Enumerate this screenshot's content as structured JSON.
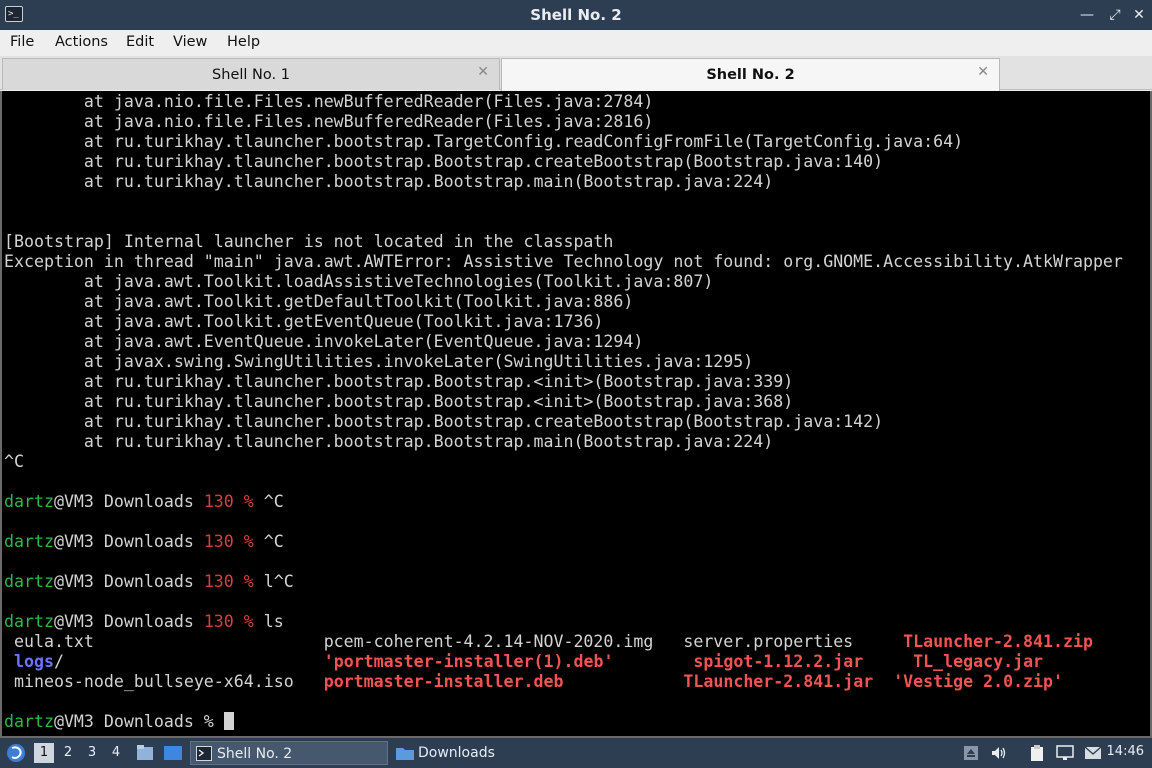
{
  "window": {
    "title": "Shell No. 2",
    "controls": {
      "minimize": "—",
      "maximize": "⤢",
      "close": "✕"
    }
  },
  "menu": [
    "File",
    "Actions",
    "Edit",
    "View",
    "Help"
  ],
  "tabs": [
    {
      "label": "Shell No. 1",
      "close": "✕",
      "active": false
    },
    {
      "label": "Shell No. 2",
      "close": "✕",
      "active": true
    }
  ],
  "terminal": {
    "lines": [
      [
        {
          "t": "        at java.nio.file.Files.newBufferedReader(Files.java:2784)"
        }
      ],
      [
        {
          "t": "        at java.nio.file.Files.newBufferedReader(Files.java:2816)"
        }
      ],
      [
        {
          "t": "        at ru.turikhay.tlauncher.bootstrap.TargetConfig.readConfigFromFile(TargetConfig.java:64)"
        }
      ],
      [
        {
          "t": "        at ru.turikhay.tlauncher.bootstrap.Bootstrap.createBootstrap(Bootstrap.java:140)"
        }
      ],
      [
        {
          "t": "        at ru.turikhay.tlauncher.bootstrap.Bootstrap.main(Bootstrap.java:224)"
        }
      ],
      [],
      [],
      [
        {
          "t": "[Bootstrap] Internal launcher is not located in the classpath"
        }
      ],
      [
        {
          "t": "Exception in thread \"main\" java.awt.AWTError: Assistive Technology not found: org.GNOME.Accessibility.AtkWrapper"
        }
      ],
      [
        {
          "t": "        at java.awt.Toolkit.loadAssistiveTechnologies(Toolkit.java:807)"
        }
      ],
      [
        {
          "t": "        at java.awt.Toolkit.getDefaultToolkit(Toolkit.java:886)"
        }
      ],
      [
        {
          "t": "        at java.awt.Toolkit.getEventQueue(Toolkit.java:1736)"
        }
      ],
      [
        {
          "t": "        at java.awt.EventQueue.invokeLater(EventQueue.java:1294)"
        }
      ],
      [
        {
          "t": "        at javax.swing.SwingUtilities.invokeLater(SwingUtilities.java:1295)"
        }
      ],
      [
        {
          "t": "        at ru.turikhay.tlauncher.bootstrap.Bootstrap.<init>(Bootstrap.java:339)"
        }
      ],
      [
        {
          "t": "        at ru.turikhay.tlauncher.bootstrap.Bootstrap.<init>(Bootstrap.java:368)"
        }
      ],
      [
        {
          "t": "        at ru.turikhay.tlauncher.bootstrap.Bootstrap.createBootstrap(Bootstrap.java:142)"
        }
      ],
      [
        {
          "t": "        at ru.turikhay.tlauncher.bootstrap.Bootstrap.main(Bootstrap.java:224)"
        }
      ],
      [
        {
          "t": "^C"
        }
      ],
      [],
      [
        {
          "t": "dartz",
          "c": "g"
        },
        {
          "t": "@VM3 Downloads "
        },
        {
          "t": "130 %",
          "c": "r"
        },
        {
          "t": " ^C"
        }
      ],
      [],
      [
        {
          "t": "dartz",
          "c": "g"
        },
        {
          "t": "@VM3 Downloads "
        },
        {
          "t": "130 %",
          "c": "r"
        },
        {
          "t": " ^C"
        }
      ],
      [],
      [
        {
          "t": "dartz",
          "c": "g"
        },
        {
          "t": "@VM3 Downloads "
        },
        {
          "t": "130 %",
          "c": "r"
        },
        {
          "t": " l^C"
        }
      ],
      [],
      [
        {
          "t": "dartz",
          "c": "g"
        },
        {
          "t": "@VM3 Downloads "
        },
        {
          "t": "130 %",
          "c": "r"
        },
        {
          "t": " ls"
        }
      ],
      [
        {
          "t": " eula.txt                       pcem-coherent-4.2.14-NOV-2020.img   server.properties     "
        },
        {
          "t": "TLauncher-2.841.zip",
          "c": "rb"
        }
      ],
      [
        {
          "t": " "
        },
        {
          "t": "logs",
          "c": "b"
        },
        {
          "t": "/                          "
        },
        {
          "t": "'portmaster-installer(1).deb'",
          "c": "rb"
        },
        {
          "t": "        "
        },
        {
          "t": "spigot-1.12.2.jar",
          "c": "rb"
        },
        {
          "t": "     "
        },
        {
          "t": "TL_legacy.jar",
          "c": "rb"
        }
      ],
      [
        {
          "t": " mineos-node_bullseye-x64.iso   "
        },
        {
          "t": "portmaster-installer.deb",
          "c": "rb"
        },
        {
          "t": "            "
        },
        {
          "t": "TLauncher-2.841.jar",
          "c": "rb"
        },
        {
          "t": "  "
        },
        {
          "t": "'Vestige 2.0.zip'",
          "c": "rb"
        }
      ],
      [],
      [
        {
          "t": "dartz",
          "c": "g"
        },
        {
          "t": "@VM3 Downloads % "
        },
        {
          "cursor": true
        }
      ]
    ]
  },
  "taskbar": {
    "workspaces": [
      "1",
      "2",
      "3",
      "4"
    ],
    "tasks": [
      {
        "label": "Shell No. 2",
        "icon": "terminal-icon",
        "active": true
      },
      {
        "label": "Downloads",
        "icon": "folder-icon",
        "active": false
      }
    ],
    "clock": "14:46"
  },
  "colors": {
    "panel": "#2e3e52",
    "prompt_user": "#2db84a",
    "prompt_status": "#d43f3f",
    "dir": "#6b73ff",
    "archive": "#f25353"
  }
}
